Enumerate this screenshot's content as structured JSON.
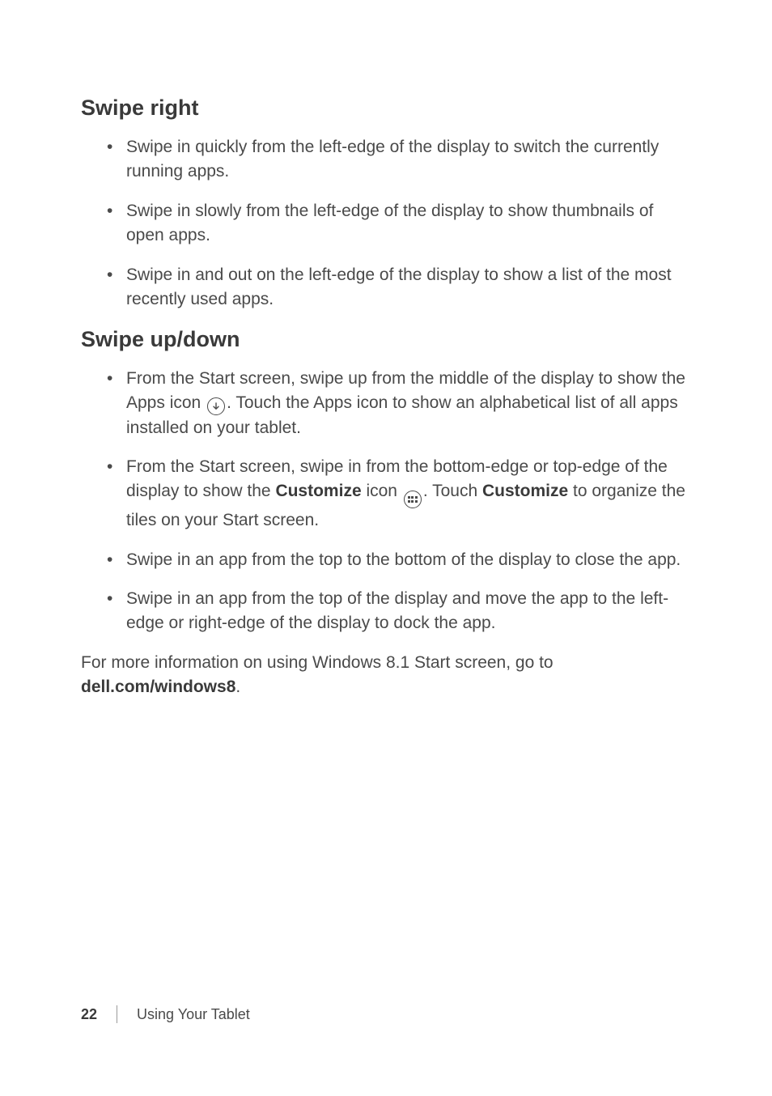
{
  "sections": [
    {
      "heading": "Swipe right",
      "bullets": [
        {
          "text": "Swipe in quickly from the left-edge of the display to switch the currently running apps."
        },
        {
          "text": "Swipe in slowly from the left-edge of the display to show thumbnails of open apps."
        },
        {
          "text": "Swipe in and out on the left-edge of the display to show a list of the most recently used apps."
        }
      ]
    },
    {
      "heading": "Swipe up/down",
      "bullets": [
        {
          "parts": {
            "a": "From the Start screen, swipe up from the middle of the display to show the Apps icon ",
            "b": ". Touch the Apps icon to show an alphabetical list of all apps installed on your tablet."
          },
          "icon": "down-arrow-circle-icon"
        },
        {
          "parts": {
            "a": "From the Start screen, swipe in from the bottom-edge or top-edge of the display to show the ",
            "b": "Customize",
            "c": " icon ",
            "d": ". Touch ",
            "e": "Customize",
            "f": " to organize the tiles on your Start screen."
          },
          "icon": "customize-grid-circle-icon"
        },
        {
          "text": "Swipe in an app from the top to the bottom of the display to close the app."
        },
        {
          "text": "Swipe in an app from the top of the display and move the app to the left-edge or right-edge of the display to dock the app."
        }
      ]
    }
  ],
  "closing": {
    "a": "For more information on using Windows 8.1 Start screen, go to ",
    "b": "dell.com/windows8",
    "c": "."
  },
  "footer": {
    "page": "22",
    "section": "Using Your Tablet"
  }
}
